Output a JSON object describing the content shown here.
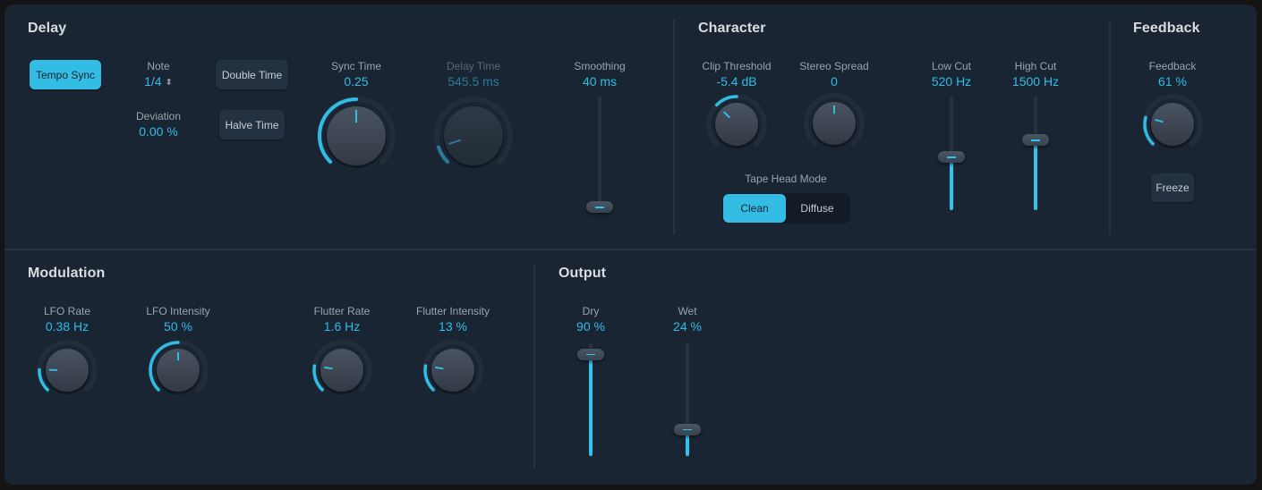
{
  "accent_color": "#2fbde6",
  "sections": {
    "delay": {
      "title": "Delay",
      "tempo_sync": {
        "label": "Tempo Sync",
        "active": true
      },
      "note": {
        "label": "Note",
        "value": "1/4",
        "icon": "stepper-icon"
      },
      "deviation": {
        "label": "Deviation",
        "value": "0.00 %"
      },
      "double_time": {
        "label": "Double Time"
      },
      "halve_time": {
        "label": "Halve Time"
      },
      "sync_time": {
        "label": "Sync Time",
        "value": "0.25",
        "position": 0.5
      },
      "delay_time": {
        "label": "Delay Time",
        "value": "545.5 ms",
        "position": 0.1,
        "disabled": true
      },
      "smoothing": {
        "label": "Smoothing",
        "value": "40 ms",
        "position": 0.03
      }
    },
    "character": {
      "title": "Character",
      "clip_threshold": {
        "label": "Clip Threshold",
        "value": "-5.4 dB",
        "position": 0.33,
        "arc_from": 0.5
      },
      "stereo_spread": {
        "label": "Stereo Spread",
        "value": "0",
        "position": 0.5,
        "arc_from": 0.5
      },
      "tape_head_mode": {
        "label": "Tape Head Mode",
        "options": [
          "Clean",
          "Diffuse"
        ],
        "selected": "Clean"
      },
      "low_cut": {
        "label": "Low Cut",
        "value": "520 Hz",
        "position": 0.47
      },
      "high_cut": {
        "label": "High Cut",
        "value": "1500 Hz",
        "position": 0.62
      }
    },
    "feedback": {
      "title": "Feedback",
      "feedback": {
        "label": "Feedback",
        "value": "61 %",
        "position": 0.22
      },
      "freeze": {
        "label": "Freeze"
      }
    },
    "modulation": {
      "title": "Modulation",
      "lfo_rate": {
        "label": "LFO Rate",
        "value": "0.38 Hz",
        "position": 0.17
      },
      "lfo_intensity": {
        "label": "LFO Intensity",
        "value": "50 %",
        "position": 0.5
      },
      "flutter_rate": {
        "label": "Flutter Rate",
        "value": "1.6 Hz",
        "position": 0.2
      },
      "flutter_intensity": {
        "label": "Flutter Intensity",
        "value": "13 %",
        "position": 0.2
      }
    },
    "output": {
      "title": "Output",
      "dry": {
        "label": "Dry",
        "value": "90 %",
        "position": 0.9
      },
      "wet": {
        "label": "Wet",
        "value": "24 %",
        "position": 0.24
      }
    }
  }
}
